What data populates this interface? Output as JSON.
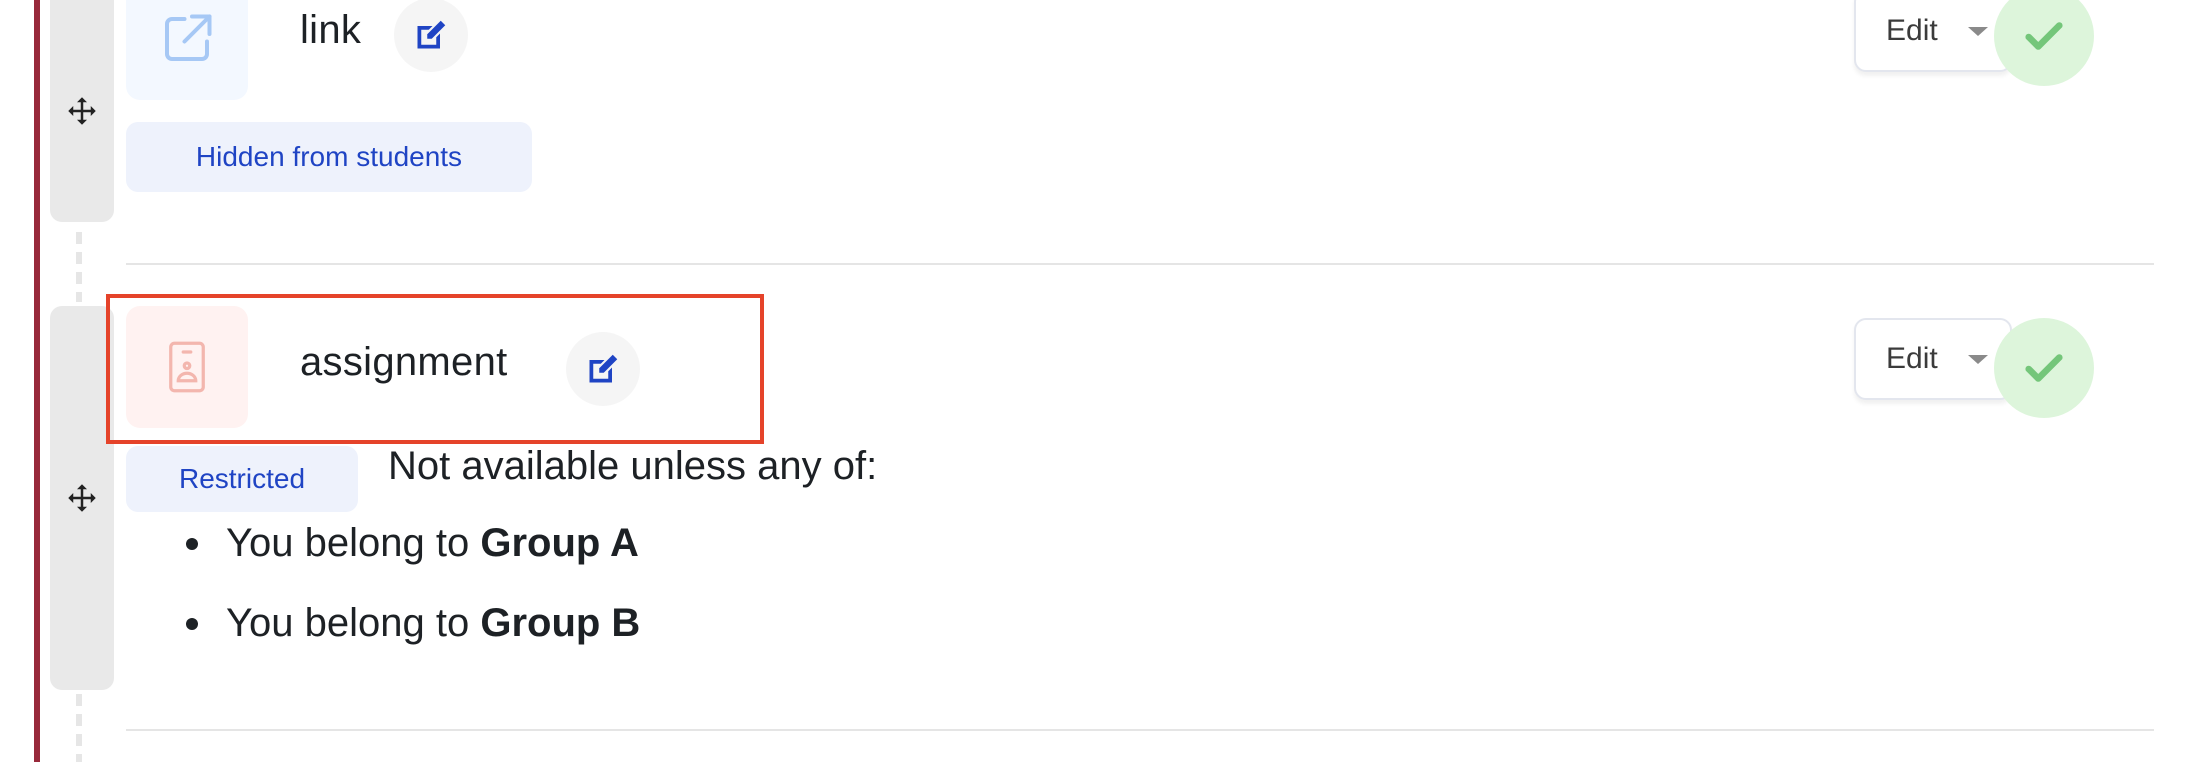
{
  "activities": [
    {
      "type": "link",
      "name": "link",
      "icon": "external-link-icon",
      "icon_color": "#a6c8f5",
      "icon_bg": "#f3f8ff",
      "badge": "Hidden from students",
      "edit_menu_label": "Edit",
      "completion": "complete"
    },
    {
      "type": "assignment",
      "name": "assignment",
      "icon": "assignment-icon",
      "icon_color": "#f3b6ae",
      "icon_bg": "#fff2f1",
      "badge": "Restricted",
      "availability": {
        "intro": "Not available unless any of:",
        "conditions": [
          {
            "prefix": "You belong to ",
            "group": "Group A"
          },
          {
            "prefix": "You belong to ",
            "group": "Group B"
          }
        ]
      },
      "edit_menu_label": "Edit",
      "completion": "complete"
    }
  ],
  "colors": {
    "section_accent": "#98293b",
    "badge_text": "#1f44c4",
    "edit_icon": "#1f44c4",
    "complete_check": "#74c67a",
    "highlight": "#e5432a"
  }
}
